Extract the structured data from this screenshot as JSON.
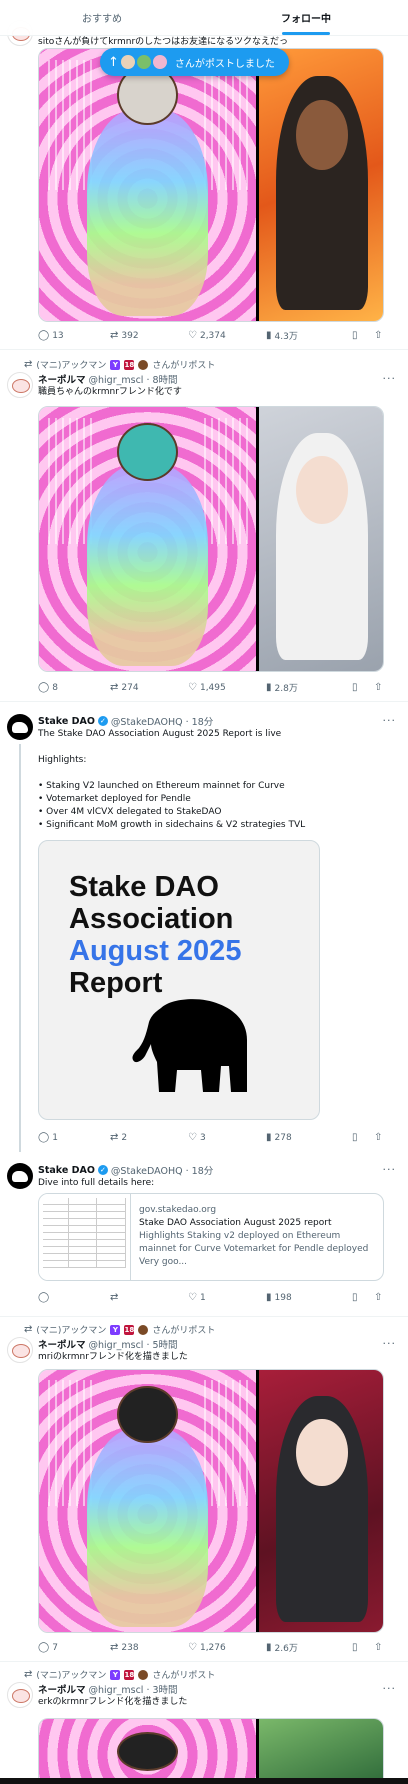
{
  "tabs": [
    {
      "label": "おすすめ"
    },
    {
      "label": "フォロー中"
    }
  ],
  "new_posts_pill": {
    "label": "さんがポストしました",
    "arrow": "↑"
  },
  "posts": [
    {
      "truncated_text": "sitoさんが負けてkrmnrのしたつはお友達になるツクなえだっ",
      "actions": {
        "replies": "13",
        "reposts": "392",
        "likes": "2,374",
        "views": "4.3万"
      }
    },
    {
      "repost_by": "(マニ)アックマン",
      "repost_suffix": "さんがリポスト",
      "name": "ネーポルマ",
      "handle": "@higr_mscl · 8時間",
      "text": "職員ちゃんのkrmnrフレンド化です",
      "actions": {
        "replies": "8",
        "reposts": "274",
        "likes": "1,495",
        "views": "2.8万"
      }
    },
    {
      "name": "Stake DAO",
      "handle": "@StakeDAOHQ · 18分",
      "text": "The Stake DAO Association August 2025 Report is live\n\nHighlights:\n\n• Staking V2 launched on Ethereum mainnet for Curve\n• Votemarket deployed for Pendle\n• Over 4M vlCVX delegated to StakeDAO\n• Significant MoM growth in sidechains & V2 strategies TVL",
      "card": {
        "line1": "Stake DAO",
        "line2": "Association",
        "line3": "August 2025",
        "line4": "Report"
      },
      "actions": {
        "replies": "1",
        "reposts": "2",
        "likes": "3",
        "views": "278"
      }
    },
    {
      "name": "Stake DAO",
      "handle": "@StakeDAOHQ · 18分",
      "text": "Dive into full details here:",
      "link": {
        "domain": "gov.stakedao.org",
        "title": "Stake DAO Association August 2025 report",
        "description": "Highlights Staking v2 deployed on Ethereum mainnet for Curve Votemarket for Pendle deployed Very goo..."
      },
      "actions": {
        "replies": "",
        "reposts": "",
        "likes": "1",
        "views": "198"
      }
    },
    {
      "repost_by": "(マニ)アックマン",
      "repost_suffix": "さんがリポスト",
      "name": "ネーポルマ",
      "handle": "@higr_mscl · 5時間",
      "text": "mriのkrmnrフレンド化を描きました",
      "actions": {
        "replies": "7",
        "reposts": "238",
        "likes": "1,276",
        "views": "2.6万"
      }
    },
    {
      "repost_by": "(マニ)アックマン",
      "repost_suffix": "さんがリポスト",
      "name": "ネーポルマ",
      "handle": "@higr_mscl · 3時間",
      "text": "erkのkrmnrフレンド化を描きました"
    }
  ],
  "badges": {
    "v": "Y",
    "r": "18",
    "p": "💩"
  },
  "colors": {
    "accent": "#1d9bf0",
    "text": "#0f1419",
    "muted": "#536471",
    "card_blue": "#3674e8"
  }
}
